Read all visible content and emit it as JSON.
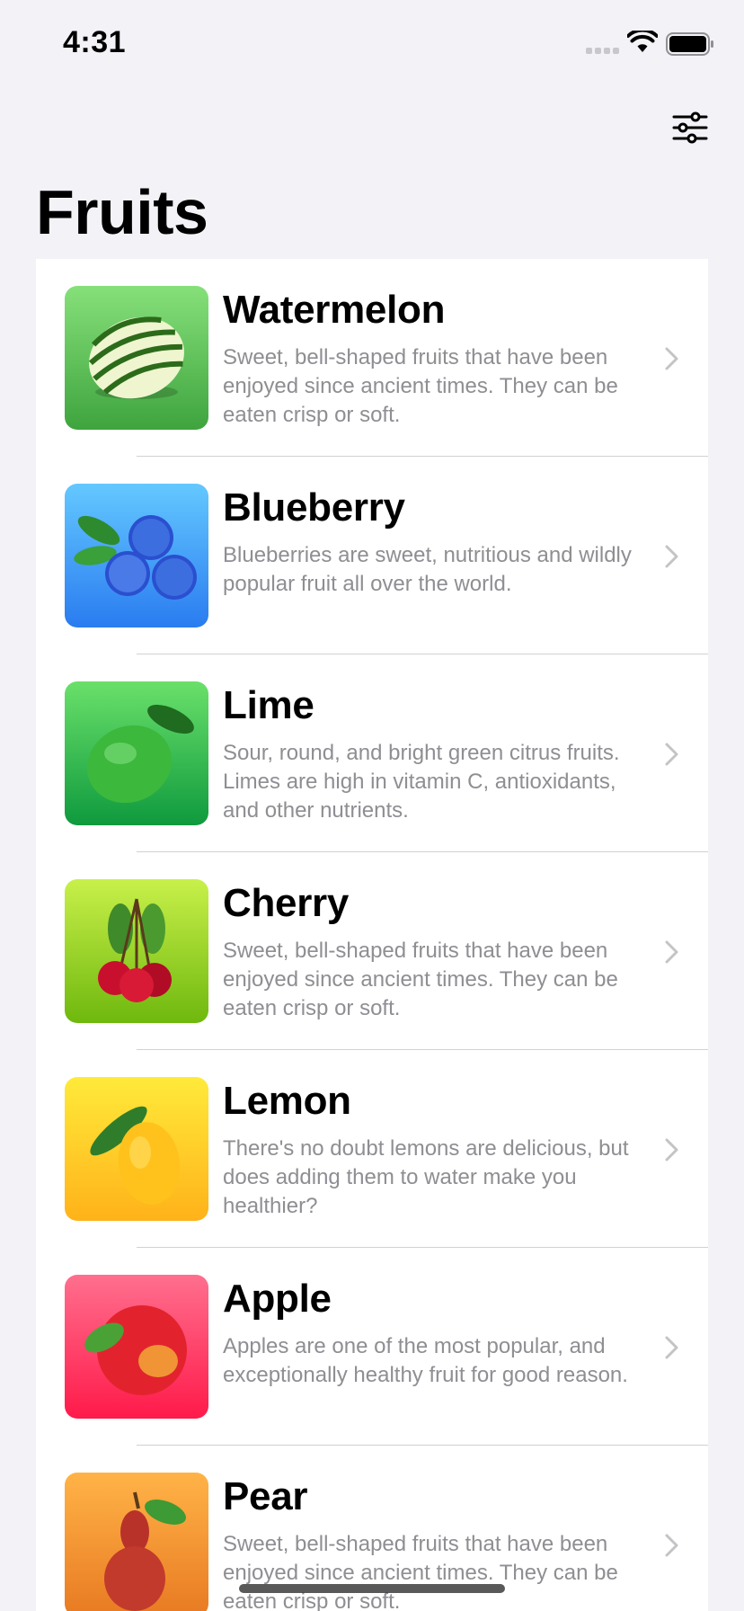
{
  "status_bar": {
    "time": "4:31"
  },
  "header": {
    "title": "Fruits",
    "filter_icon": "sliders-icon"
  },
  "fruits": [
    {
      "name": "Watermelon",
      "description": "Sweet, bell-shaped fruits that have been enjoyed since ancient times. They can be eaten crisp or soft.",
      "gradient": [
        "#86e07a",
        "#3fa43e"
      ]
    },
    {
      "name": "Blueberry",
      "description": "Blueberries are sweet, nutritious and wildly popular fruit all over the world.",
      "gradient": [
        "#64c8ff",
        "#2a7cf0"
      ]
    },
    {
      "name": "Lime",
      "description": "Sour, round, and bright green citrus fruits. Limes are high in vitamin C, antioxidants, and other nutrients.",
      "gradient": [
        "#6ae06a",
        "#0f9a3e"
      ]
    },
    {
      "name": "Cherry",
      "description": "Sweet, bell-shaped fruits that have been enjoyed since ancient times. They can be eaten crisp or soft.",
      "gradient": [
        "#c8f04a",
        "#6fb80e"
      ]
    },
    {
      "name": "Lemon",
      "description": "There's no doubt lemons are delicious, but does adding them to water make you healthier?",
      "gradient": [
        "#ffea3a",
        "#ffb219"
      ]
    },
    {
      "name": "Apple",
      "description": "Apples are one of the most popular, and exceptionally healthy fruit for good reason.",
      "gradient": [
        "#ff6f8e",
        "#ff1a4a"
      ]
    },
    {
      "name": "Pear",
      "description": "Sweet, bell-shaped fruits that have been enjoyed since ancient times. They can be eaten crisp or soft.",
      "gradient": [
        "#ffb347",
        "#e87a22"
      ]
    }
  ]
}
